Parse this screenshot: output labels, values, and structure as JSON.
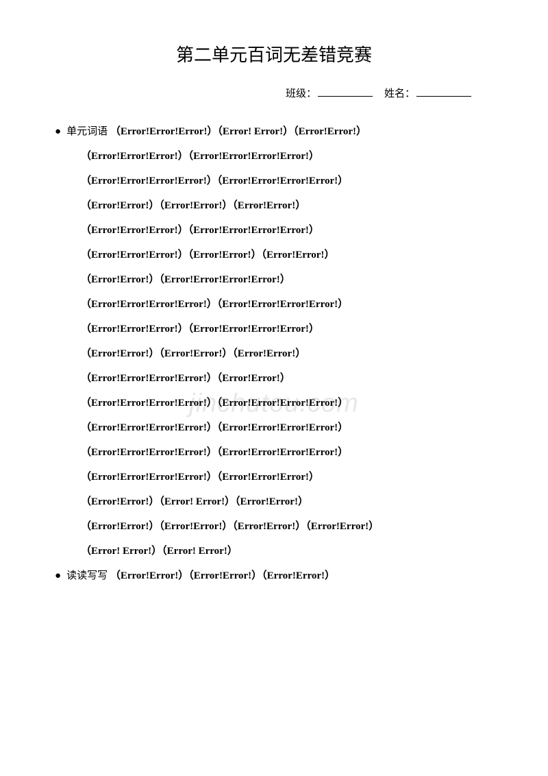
{
  "title": "第二单元百词无差错竞赛",
  "form": {
    "class_label": "班级：",
    "name_label": "姓名："
  },
  "sections": {
    "s1": {
      "label": "单元词语",
      "lines": [
        "（Error!Error!Error!）（Error!   Error!）（Error!Error!）",
        "（Error!Error!Error!）（Error!Error!Error!Error!）",
        "（Error!Error!Error!Error!）（Error!Error!Error!Error!）",
        "（Error!Error!）（Error!Error!）（Error!Error!）",
        "（Error!Error!Error!）（Error!Error!Error!Error!）",
        "（Error!Error!Error!）（Error!Error!）（Error!Error!）",
        "（Error!Error!）（Error!Error!Error!Error!）",
        "（Error!Error!Error!Error!）（Error!Error!Error!Error!）",
        "（Error!Error!Error!）（Error!Error!Error!Error!）",
        "（Error!Error!）（Error!Error!）（Error!Error!）",
        "（Error!Error!Error!Error!）（Error!Error!）",
        "（Error!Error!Error!Error!）（Error!Error!Error!Error!）",
        "（Error!Error!Error!Error!）（Error!Error!Error!Error!）",
        "（Error!Error!Error!Error!）（Error!Error!Error!Error!）",
        "（Error!Error!Error!Error!）（Error!Error!Error!）",
        "（Error!Error!）（Error!                Error!）（Error!Error!）",
        "（Error!Error!）（Error!Error!）（Error!Error!）（Error!Error!）",
        "（Error! Error!）（Error! Error!）"
      ]
    },
    "s2": {
      "label": "读读写写",
      "lines": [
        "（Error!Error!）（Error!Error!）（Error!Error!）"
      ]
    }
  },
  "watermark": "jinchutou.com"
}
